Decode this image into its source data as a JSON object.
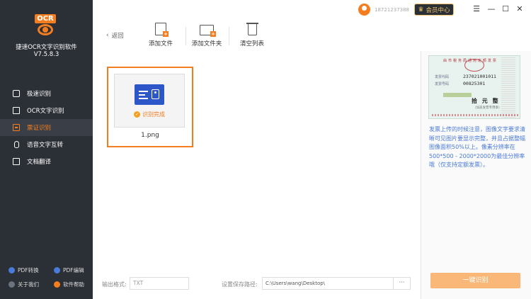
{
  "app": {
    "name": "捷速OCR文字识别软件",
    "version": "V7.5.8.3",
    "logo_text": "OCR"
  },
  "sidebar": {
    "items": [
      {
        "label": "极速识别",
        "icon": "speed-icon",
        "active": false
      },
      {
        "label": "OCR文字识别",
        "icon": "ocr-scan-icon",
        "active": false
      },
      {
        "label": "票证识别",
        "icon": "ticket-icon",
        "active": true
      },
      {
        "label": "语音文字互转",
        "icon": "microphone-icon",
        "active": false
      },
      {
        "label": "文档翻译",
        "icon": "translate-icon",
        "active": false
      }
    ],
    "tools": [
      {
        "label": "PDF转换",
        "icon": "pdf-convert-icon"
      },
      {
        "label": "PDF编辑",
        "icon": "pdf-edit-icon"
      },
      {
        "label": "关于我们",
        "icon": "info-icon"
      },
      {
        "label": "软件帮助",
        "icon": "help-icon"
      }
    ]
  },
  "titlebar": {
    "phone": "18721237388",
    "vip_label": "会员中心",
    "buttons": [
      "menu-icon",
      "minimize-icon",
      "maximize-icon",
      "close-icon"
    ]
  },
  "toolbar": {
    "back_label": "返回",
    "add_file": "添加文件",
    "add_folder": "添加文件夹",
    "clear_list": "清空列表"
  },
  "file_card": {
    "status": "识别完成",
    "filename": "1.png"
  },
  "ticket_preview": {
    "header": "由 市 税 务 局 通 用 定 额 发 票",
    "code_label": "发票代码",
    "code_value": "237021001011",
    "number_label": "发票号码",
    "number_value": "00825301",
    "amount": "拾 元 整",
    "amount_sub": "（加盖发票专用章）"
  },
  "hint": "发票上传的时候注意，图像文字要求清晰可见图片要显示完整，并且占据整幅图像面积50%以上。像素分辨率在500*500 - 2000*2000为最佳分辨率哦（仅支持定额发票）。",
  "recognize_button": "一键识别",
  "bottom": {
    "format_label": "输出格式:",
    "format_value": "TXT",
    "path_label": "设置保存路径:",
    "path_value": "C:\\Users\\wang\\Desktop\\",
    "browse_label": "···"
  },
  "colors": {
    "accent": "#f47d20",
    "sidebar_bg": "#2b2f36",
    "button_bg": "#f9b778",
    "hint_text": "#4a7bd9"
  }
}
